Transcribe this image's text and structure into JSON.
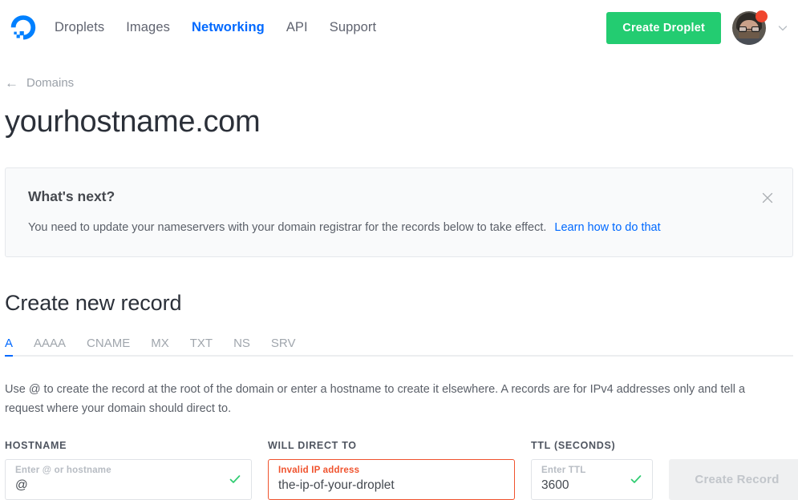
{
  "header": {
    "logo_icon": "digitalocean-logo-icon",
    "nav": [
      {
        "label": "Droplets",
        "active": false
      },
      {
        "label": "Images",
        "active": false
      },
      {
        "label": "Networking",
        "active": true
      },
      {
        "label": "API",
        "active": false
      },
      {
        "label": "Support",
        "active": false
      }
    ],
    "create_droplet_label": "Create Droplet",
    "avatar_icon": "user-avatar",
    "notification_badge_color": "#f0462e",
    "chevron_icon": "chevron-down-icon",
    "accent_color": "#0069ff",
    "green_color": "#23cc71"
  },
  "breadcrumb": {
    "back_icon": "arrow-left-icon",
    "label": "Domains"
  },
  "page_title": "yourhostname.com",
  "notice": {
    "title": "What's next?",
    "body": "You need to update your nameservers with your domain registrar for the records below to take effect.",
    "link_label": "Learn how to do that",
    "close_icon": "close-icon"
  },
  "section": {
    "title": "Create new record",
    "tabs": [
      {
        "label": "A",
        "active": true
      },
      {
        "label": "AAAA",
        "active": false
      },
      {
        "label": "CNAME",
        "active": false
      },
      {
        "label": "MX",
        "active": false
      },
      {
        "label": "TXT",
        "active": false
      },
      {
        "label": "NS",
        "active": false
      },
      {
        "label": "SRV",
        "active": false
      }
    ],
    "description": "Use @ to create the record at the root of the domain or enter a hostname to create it elsewhere. A records are for IPv4 addresses only and tell a request where your domain should direct to."
  },
  "form": {
    "hostname": {
      "label": "HOSTNAME",
      "placeholder": "Enter @ or hostname",
      "value": "@",
      "state": "valid",
      "status_icon": "check-icon"
    },
    "will_direct_to": {
      "label": "WILL DIRECT TO",
      "placeholder": "Invalid IP address",
      "value": "the-ip-of-your-droplet",
      "state": "error",
      "error_color": "#f0532e"
    },
    "ttl": {
      "label": "TTL (SECONDS)",
      "placeholder": "Enter TTL",
      "value": "3600",
      "state": "valid",
      "status_icon": "check-icon"
    },
    "submit": {
      "label": "Create Record",
      "disabled": true
    }
  }
}
